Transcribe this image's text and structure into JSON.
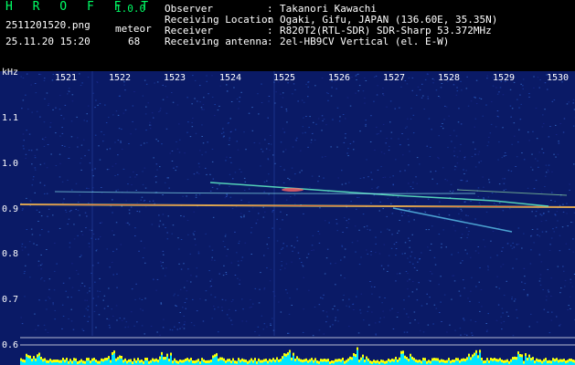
{
  "app": {
    "title": "H R O F F T",
    "version": "1.0.0"
  },
  "file": {
    "name": "2511201520.png",
    "datetime": "25.11.20 15:20"
  },
  "meteor": {
    "label": "meteor",
    "count": "68"
  },
  "info": [
    {
      "label": "Observer",
      "value": "Takanori Kawachi"
    },
    {
      "label": "Receiving Location",
      "value": "Ogaki, Gifu, JAPAN (136.60E, 35.35N)"
    },
    {
      "label": "Receiver",
      "value": "R820T2(RTL-SDR) SDR-Sharp 53.372MHz"
    },
    {
      "label": "Receiving antenna",
      "value": "2el-HB9CV Vertical (el. E-W)"
    }
  ],
  "separator": ":",
  "axis": {
    "yunit": "kHz",
    "yticks": [
      "1.1",
      "1.0",
      "0.9",
      "0.8",
      "0.7",
      "0.6"
    ],
    "xticks": [
      "1521",
      "1522",
      "1523",
      "1524",
      "1525",
      "1526",
      "1527",
      "1528",
      "1529",
      "1530"
    ]
  },
  "colors": {
    "title": "#00ff66",
    "background": "#0a1a66",
    "signal_bar": "#00e5ff",
    "signal_peak": "#ffff00"
  }
}
